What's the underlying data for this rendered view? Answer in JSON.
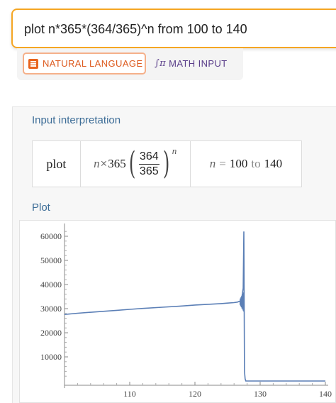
{
  "search": {
    "query": "plot n*365*(364/365)^n from 100 to 140"
  },
  "modes": {
    "natural_label": "NATURAL LANGUAGE",
    "math_label": "MATH INPUT"
  },
  "pods": {
    "input_title": "Input interpretation",
    "plot_title": "Plot"
  },
  "interpretation": {
    "command": "plot",
    "var": "n",
    "times": "×",
    "coef": "365",
    "numerator": "364",
    "denominator": "365",
    "exponent": "n",
    "range_var": "n",
    "range_eq": "=",
    "range_from": "100",
    "range_to_word": "to",
    "range_to": "140"
  },
  "colors": {
    "accent": "#f5a623",
    "natural": "#dd5a1e",
    "math": "#5a3e8a",
    "pod_title": "#3d6d97",
    "line": "#5b7fb6"
  },
  "chart_data": {
    "type": "line",
    "xlim": [
      100,
      140
    ],
    "ylim": [
      0,
      65000
    ],
    "x_ticks": [
      110,
      120,
      130,
      140
    ],
    "y_ticks": [
      10000,
      20000,
      30000,
      40000,
      50000,
      60000
    ],
    "series": [
      {
        "x": [
          100,
          102,
          105,
          108,
          110,
          112,
          115,
          118,
          120,
          122,
          124,
          125,
          126,
          126.5,
          127,
          127.2,
          127.4,
          127.5,
          127.6,
          127.7,
          127.8,
          128,
          130,
          135,
          140
        ],
        "values": [
          27600,
          28100,
          28700,
          29300,
          29700,
          30100,
          30600,
          31100,
          31500,
          31800,
          32100,
          32300,
          32500,
          32700,
          33200,
          34800,
          38500,
          62000,
          4000,
          900,
          0,
          0,
          0,
          0,
          0
        ]
      }
    ]
  }
}
